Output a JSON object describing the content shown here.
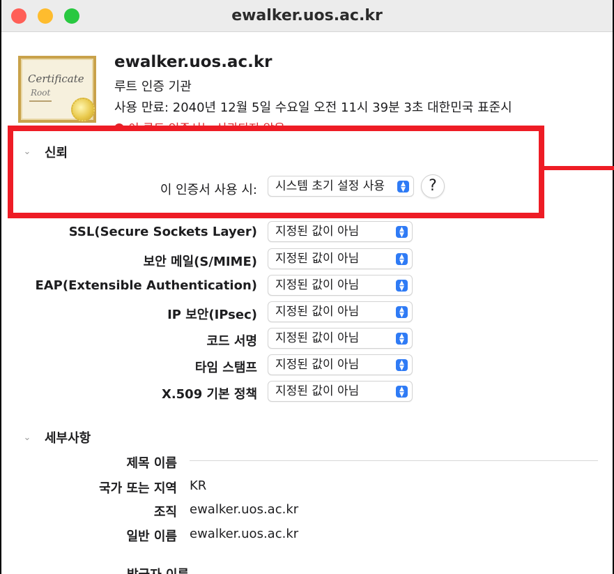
{
  "window": {
    "title": "ewalker.uos.ac.kr"
  },
  "certificate": {
    "icon_text_1": "Certificate",
    "icon_text_2": "Root",
    "name": "ewalker.uos.ac.kr",
    "kind": "루트 인증 기관",
    "expiry": "사용 만료: 2040년 12월 5일 수요일 오전 11시 39분 3초 대한민국 표준시",
    "warning": "이 루트 인증서는 신뢰되지 않음"
  },
  "trust": {
    "section_title": "신뢰",
    "use_label": "이 인증서 사용 시:",
    "use_value": "시스템 초기 설정 사용",
    "help_label": "?",
    "rows": [
      {
        "label": "SSL(Secure Sockets Layer)",
        "value": "지정된 값이 아님"
      },
      {
        "label": "보안 메일(S/MIME)",
        "value": "지정된 값이 아님"
      },
      {
        "label": "EAP(Extensible Authentication)",
        "value": "지정된 값이 아님"
      },
      {
        "label": "IP 보안(IPsec)",
        "value": "지정된 값이 아님"
      },
      {
        "label": "코드 서명",
        "value": "지정된 값이 아님"
      },
      {
        "label": "타임 스탬프",
        "value": "지정된 값이 아님"
      },
      {
        "label": "X.509 기본 정책",
        "value": "지정된 값이 아님"
      }
    ]
  },
  "details": {
    "section_title": "세부사항",
    "subject_header": "제목 이름",
    "fields": [
      {
        "label": "국가 또는 지역",
        "value": "KR"
      },
      {
        "label": "조직",
        "value": "ewalker.uos.ac.kr"
      },
      {
        "label": "일반 이름",
        "value": "ewalker.uos.ac.kr"
      }
    ],
    "issuer_header": "발급자 이름"
  },
  "colors": {
    "highlight": "#ee1c25",
    "stepper": "#2f7bf5",
    "warning": "#e0262b"
  }
}
